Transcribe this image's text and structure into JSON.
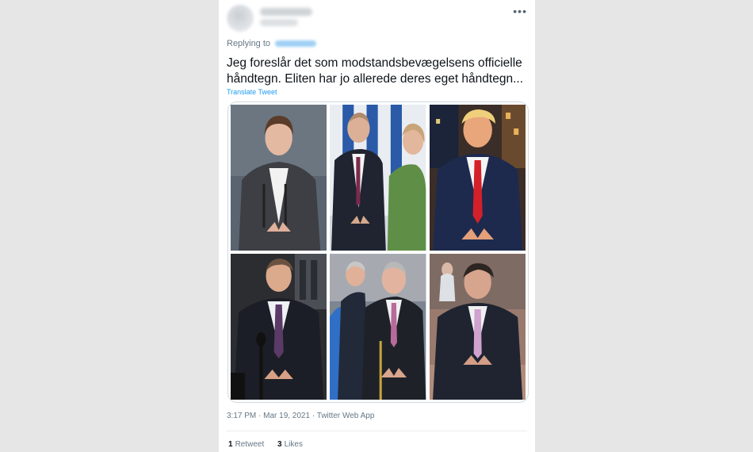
{
  "tweet": {
    "more_icon": "more-horizontal-icon",
    "replying_label": "Replying to",
    "text": "Jeg foreslår det som modstandsbevægelsens officielle håndtegn. Eliten har jo allerede deres eget håndtegn...",
    "translate_label": "Translate Tweet",
    "timestamp": "3:17 PM · Mar 19, 2021 · Twitter Web App",
    "retweets": {
      "count": "1",
      "label": "Retweet"
    },
    "likes": {
      "count": "3",
      "label": "Likes"
    }
  },
  "media": {
    "photo_count": 6,
    "colors": {
      "border": "#cfd9de",
      "link": "#1d9bf0"
    }
  }
}
